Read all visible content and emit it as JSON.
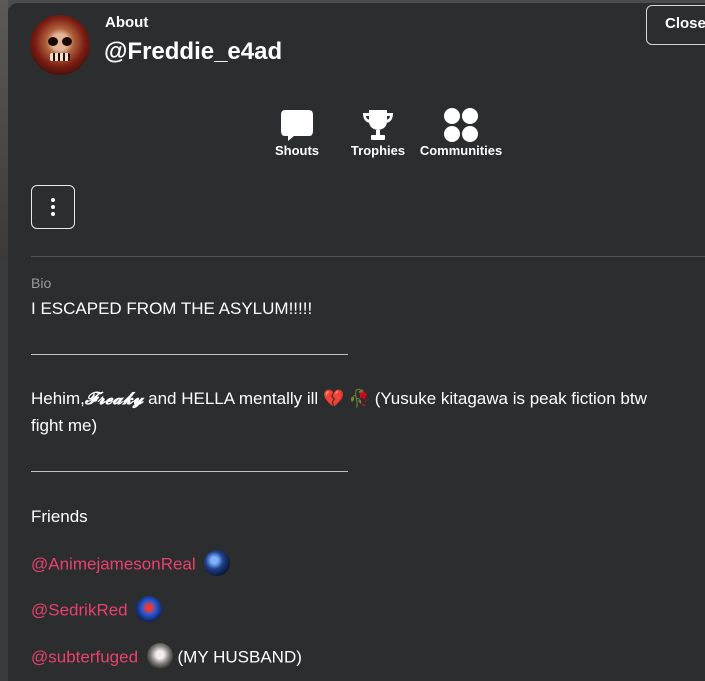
{
  "header": {
    "about_label": "About",
    "username": "@Freddie_e4ad",
    "close_label": "Close"
  },
  "nav": [
    {
      "label": "Shouts",
      "icon": "speech-bubble-icon"
    },
    {
      "label": "Trophies",
      "icon": "trophy-icon"
    },
    {
      "label": "Communities",
      "icon": "communities-dots-icon"
    }
  ],
  "bio": {
    "label": "Bio",
    "line1": "I ESCAPED FROM THE ASYLUM!!!!!",
    "line2_prefix": "Hehim,",
    "line2_freaky": "𝓕𝓻𝓮𝓪𝓴𝔂",
    "line2_mid": " and HELLA mentally ill ",
    "line2_emoji1": "💔",
    "line2_emoji2": "🥀",
    "line2_suffix": " (Yusuke kitagawa is peak fiction btw",
    "line3": "fight me)",
    "friends_heading": "Friends",
    "friends": [
      {
        "handle": "@AnimejamesonReal",
        "note": ""
      },
      {
        "handle": "@SedrikRed",
        "note": ""
      },
      {
        "handle": "@subterfuged",
        "note": "(MY HUSBAND)"
      }
    ]
  },
  "colors": {
    "panel_bg": "#2b2d2e",
    "mention": "#e8426d",
    "text": "#ffffff",
    "muted": "#9a9b9c"
  }
}
